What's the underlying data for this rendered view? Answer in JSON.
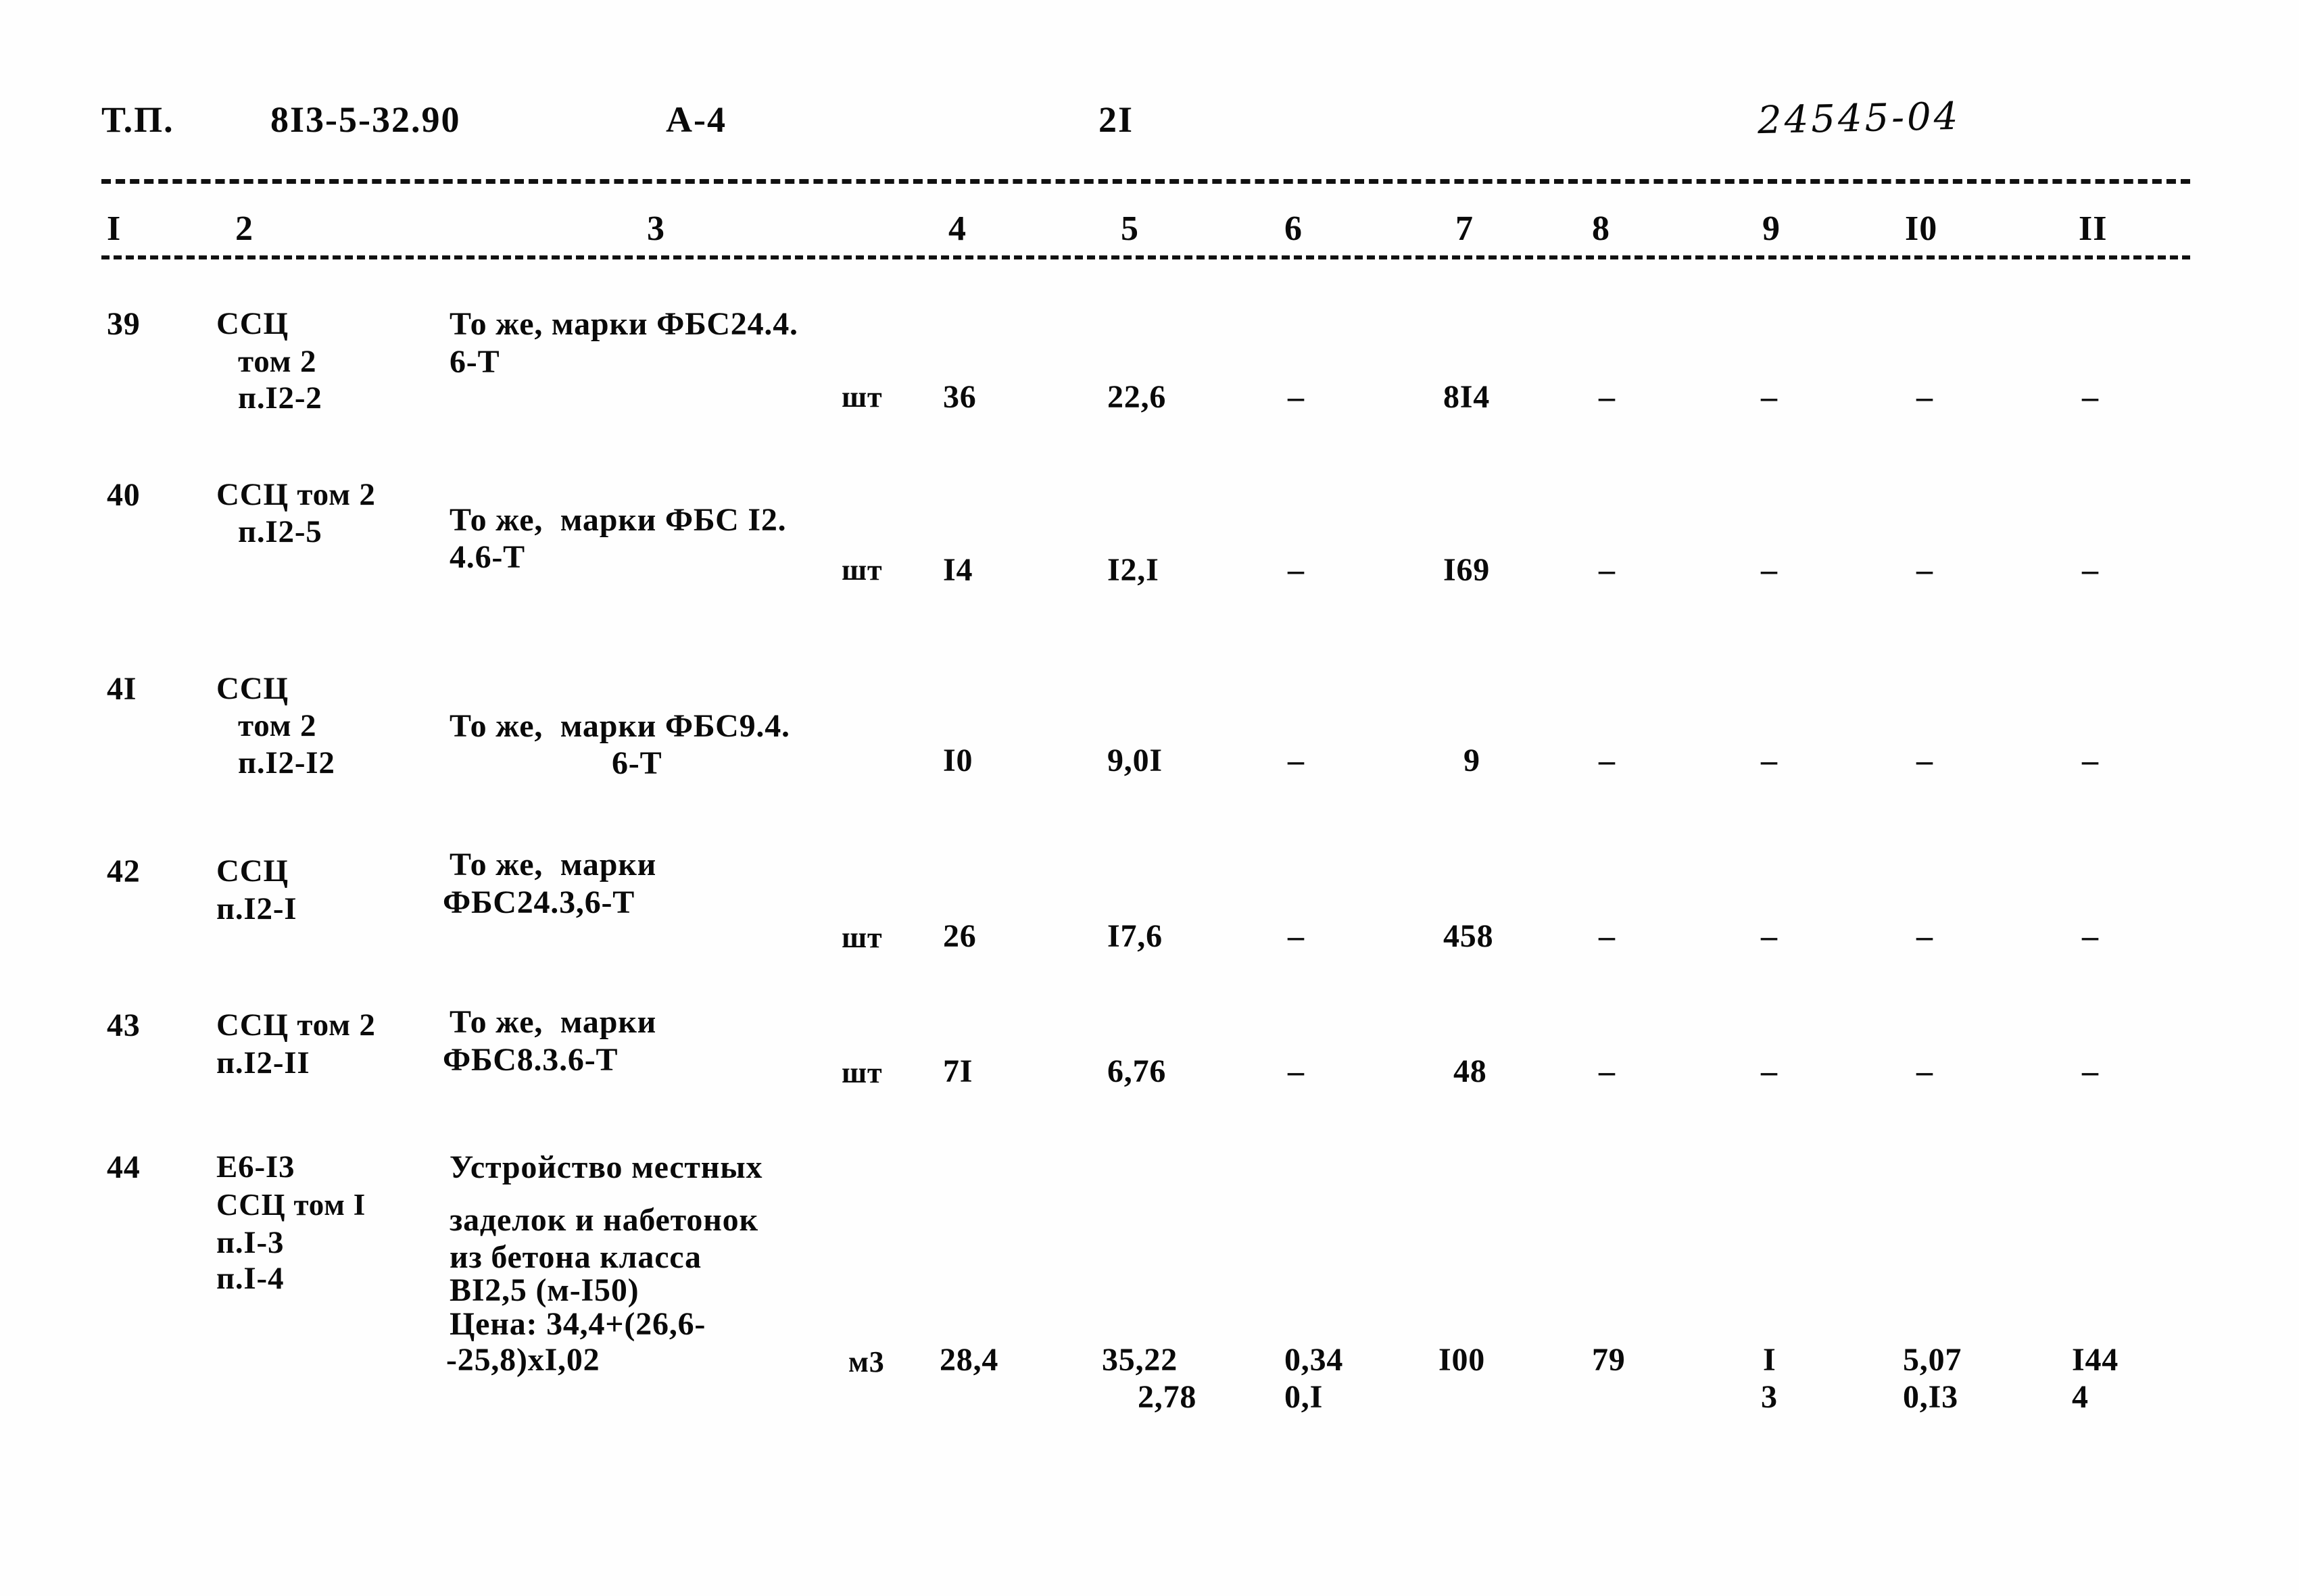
{
  "document": {
    "header": {
      "doc_type": "Т.П.",
      "series": "8I3-5-32.90",
      "album": "A-4",
      "page": "2I",
      "archive_code": "24545-04"
    },
    "column_headers": [
      "I",
      "2",
      "3",
      "4",
      "5",
      "6",
      "7",
      "8",
      "9",
      "I0",
      "II"
    ],
    "rows": [
      {
        "num": "39",
        "ref_lines": [
          "ССЦ",
          "том 2",
          "п.I2-2"
        ],
        "desc_lines": [
          "То же, марки ФБС24.4.",
          "6-Т"
        ],
        "unit": "шт",
        "c4": "36",
        "c5": "22,6",
        "c6": "–",
        "c7": "8I4",
        "c8": "–",
        "c9": "–",
        "c10": "–",
        "c11": "–"
      },
      {
        "num": "40",
        "ref_lines": [
          "ССЦ том 2",
          "п.I2-5"
        ],
        "desc_lines": [
          "То же,  марки ФБС I2.",
          "4.6-Т"
        ],
        "unit": "шт",
        "c4": "I4",
        "c5": "I2,I",
        "c6": "–",
        "c7": "I69",
        "c8": "–",
        "c9": "–",
        "c10": "–",
        "c11": "–"
      },
      {
        "num": "4I",
        "ref_lines": [
          "ССЦ",
          "том 2",
          "п.I2-I2"
        ],
        "desc_lines": [
          "То же,  марки ФБС9.4.",
          "6-Т"
        ],
        "unit": "",
        "c4": "I0",
        "c5": "9,0I",
        "c6": "–",
        "c7": "9",
        "c8": "–",
        "c9": "–",
        "c10": "–",
        "c11": "–"
      },
      {
        "num": "42",
        "ref_lines": [
          "ССЦ",
          "п.I2-I"
        ],
        "desc_lines": [
          "То же,  марки",
          "ФБС24.3,6-Т"
        ],
        "unit": "шт",
        "c4": "26",
        "c5": "I7,6",
        "c6": "–",
        "c7": "458",
        "c8": "–",
        "c9": "–",
        "c10": "–",
        "c11": "–"
      },
      {
        "num": "43",
        "ref_lines": [
          "ССЦ том 2",
          "п.I2-II"
        ],
        "desc_lines": [
          "То же,  марки",
          "ФБС8.3.6-Т"
        ],
        "unit": "шт",
        "c4": "7I",
        "c5": "6,76",
        "c6": "–",
        "c7": "48",
        "c8": "–",
        "c9": "–",
        "c10": "–",
        "c11": "–"
      },
      {
        "num": "44",
        "ref_lines": [
          "Е6-I3",
          "ССЦ том I",
          "п.I-3",
          "п.I-4"
        ],
        "desc_lines": [
          "Устройство местных",
          "заделок и набетонок",
          "из бетона класса",
          "ВI2,5 (м-I50)",
          "Цена: 34,4+(26,6-",
          "-25,8)хI,02"
        ],
        "unit": "м3",
        "c4": "28,4",
        "c5": "35,22",
        "c5b": "2,78",
        "c6": "0,34",
        "c6b": "0,I",
        "c7": "I00",
        "c8": "79",
        "c9": "I",
        "c9b": "3",
        "c10": "5,07",
        "c10b": "0,I3",
        "c11": "I44",
        "c11b": "4"
      }
    ]
  }
}
